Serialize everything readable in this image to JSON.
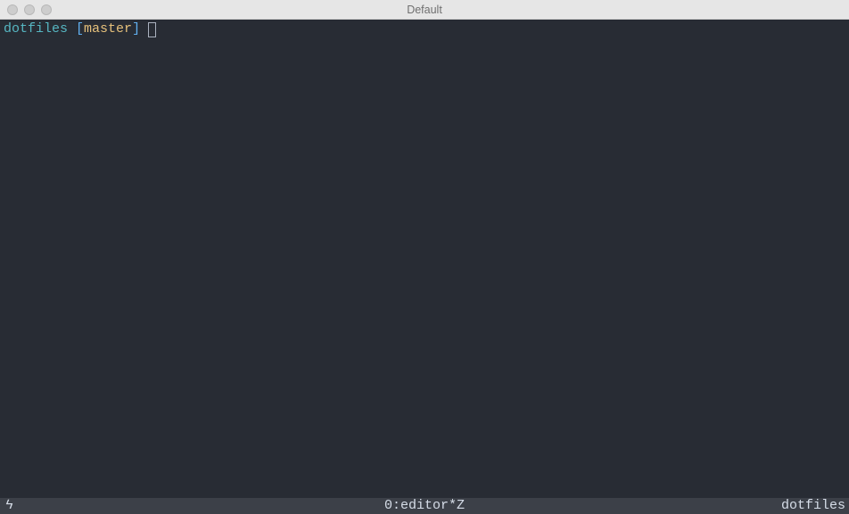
{
  "window": {
    "title": "Default"
  },
  "prompt": {
    "directory": "dotfiles",
    "bracket_open": "[",
    "branch": "master",
    "bracket_close": "]"
  },
  "statusbar": {
    "left_symbol": "ϟ",
    "center": "0:editor*Z",
    "right": "dotfiles"
  }
}
